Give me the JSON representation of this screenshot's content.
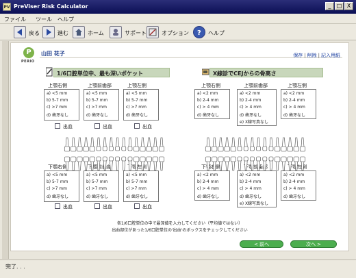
{
  "window": {
    "title": "PreViser Risk Calculator",
    "icon_text": "PV",
    "controls": [
      "_",
      "□",
      "X"
    ]
  },
  "menu": [
    "ファイル",
    "ツール",
    "ヘルプ"
  ],
  "toolbar": [
    {
      "label": "戻る",
      "icon": "back-arrow-icon"
    },
    {
      "label": "進む",
      "icon": "forward-arrow-icon"
    },
    {
      "label": "ホーム",
      "icon": "home-icon"
    },
    {
      "label": "サポート",
      "icon": "support-icon"
    },
    {
      "label": "オプション",
      "icon": "options-icon"
    },
    {
      "label": "ヘルプ",
      "icon": "help-icon"
    }
  ],
  "brand": {
    "logo_letter": "P",
    "logo_text": "PERIO"
  },
  "patient_name": "山田 花子",
  "top_links": [
    "保存",
    "削除",
    "記入用紙"
  ],
  "left_section": {
    "title": "1/6口腔単位中、最も深いポケット",
    "upper_groups": [
      {
        "label": "上顎右側",
        "options": [
          "a) <5 mm",
          "b) 5-7 mm",
          "c) >7 mm",
          "d) 歯牙なし"
        ],
        "bleeding": "出血"
      },
      {
        "label": "上顎前歯部",
        "options": [
          "a) <5 mm",
          "b) 5-7 mm",
          "c) >7 mm",
          "d) 歯牙なし"
        ],
        "bleeding": "出血"
      },
      {
        "label": "上顎左側",
        "options": [
          "a) <5 mm",
          "b) 5-7 mm",
          "c) >7 mm",
          "d) 歯牙なし"
        ],
        "bleeding": "出血"
      }
    ],
    "lower_groups": [
      {
        "label": "下顎右側",
        "options": [
          "a) <5 mm",
          "b) 5-7 mm",
          "c) >7 mm",
          "d) 歯牙なし"
        ],
        "bleeding": "出血"
      },
      {
        "label": "下顎前歯部",
        "options": [
          "a) <5 mm",
          "b) 5-7 mm",
          "c) >7 mm",
          "d) 歯牙なし"
        ],
        "bleeding": "出血"
      },
      {
        "label": "下顎左側",
        "options": [
          "a) <5 mm",
          "b) 5-7 mm",
          "c) >7 mm",
          "d) 歯牙なし"
        ],
        "bleeding": "出血"
      }
    ]
  },
  "right_section": {
    "title": "X線診でCEJからの骨高さ",
    "upper_groups": [
      {
        "label": "上顎右側",
        "options": [
          "a) <2 mm",
          "b) 2-4 mm",
          "c) > 4 mm",
          "d) 歯牙なし"
        ]
      },
      {
        "label": "上顎前歯部",
        "options": [
          "a) <2 mm",
          "b) 2-4 mm",
          "c) > 4 mm",
          "d) 歯牙なし",
          "e) X線写真なし"
        ]
      },
      {
        "label": "上顎左側",
        "options": [
          "a) <2 mm",
          "b) 2-4 mm",
          "c) > 4 mm",
          "d) 歯牙なし"
        ]
      }
    ],
    "lower_groups": [
      {
        "label": "下顎右側",
        "options": [
          "a) <2 mm",
          "b) 2-4 mm",
          "c) > 4 mm",
          "d) 歯牙なし"
        ]
      },
      {
        "label": "下顎前歯部",
        "options": [
          "a) <2 mm",
          "b) 2-4 mm",
          "c) > 4 mm",
          "d) 歯牙なし",
          "e) X線写真なし"
        ]
      },
      {
        "label": "下顎左側",
        "options": [
          "a) <2 mm",
          "b) 2-4 mm",
          "c) > 4 mm",
          "d) 歯牙なし"
        ]
      }
    ]
  },
  "instructions": [
    "各1/6口腔単位の中で最深値を入力してください（平均値ではない）",
    "出血部位があった1/6口腔単位の'出血'のボックスをチェックしてください"
  ],
  "nav": {
    "prev": "< 前へ",
    "next": "次へ >"
  },
  "status": "完了. . .",
  "colors": {
    "section_header": "#c8d7bb",
    "nav_button": "#4cae4f",
    "titlebar": "#0b0f55",
    "link": "#1b3fa0"
  }
}
